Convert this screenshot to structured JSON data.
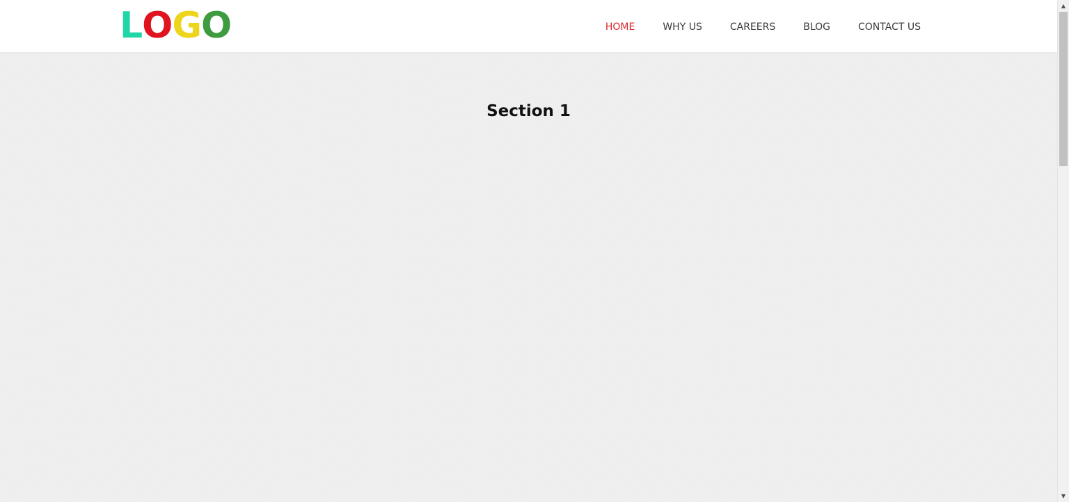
{
  "logo": {
    "letters": [
      {
        "char": "L",
        "color": "#1fd6a6"
      },
      {
        "char": "O",
        "color": "#e0141e"
      },
      {
        "char": "G",
        "color": "#ecd51a"
      },
      {
        "char": "O",
        "color": "#3f9b3f"
      }
    ]
  },
  "nav": {
    "items": [
      {
        "label": "HOME",
        "active": true
      },
      {
        "label": "WHY US",
        "active": false
      },
      {
        "label": "CAREERS",
        "active": false
      },
      {
        "label": "BLOG",
        "active": false
      },
      {
        "label": "CONTACT US",
        "active": false
      }
    ]
  },
  "main": {
    "section_title": "Section 1"
  },
  "scrollbar": {
    "up_arrow_icon": "triangle-up-icon",
    "down_arrow_icon": "triangle-down-icon",
    "up_glyph": "▲",
    "down_glyph": "▼"
  },
  "colors": {
    "accent": "#d9262c",
    "nav_text": "#3a3a3a",
    "heading": "#111111"
  }
}
